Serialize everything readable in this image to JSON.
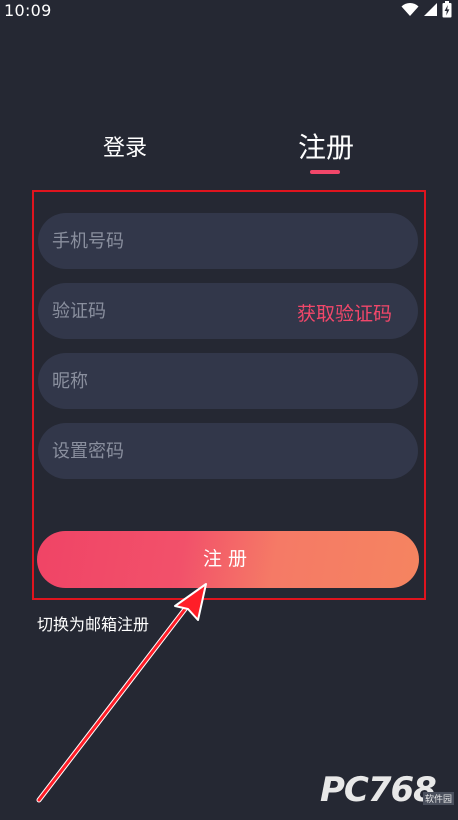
{
  "status_bar": {
    "time": "10:09",
    "icons": [
      "wifi-icon",
      "signal-icon",
      "battery-charging-icon"
    ]
  },
  "tabs": {
    "login_label": "登录",
    "register_label": "注册",
    "active": "register"
  },
  "form": {
    "phone_placeholder": "手机号码",
    "code_placeholder": "验证码",
    "get_code_label": "获取验证码",
    "nickname_placeholder": "昵称",
    "password_placeholder": "设置密码"
  },
  "register_button_label": "注册",
  "switch_email_label": "切换为邮箱注册",
  "watermark": {
    "text": "PC768",
    "sub": "软件园"
  },
  "colors": {
    "background": "#252833",
    "field": "#32374a",
    "accent": "#f2476a",
    "highlight_box": "#e0141e"
  }
}
